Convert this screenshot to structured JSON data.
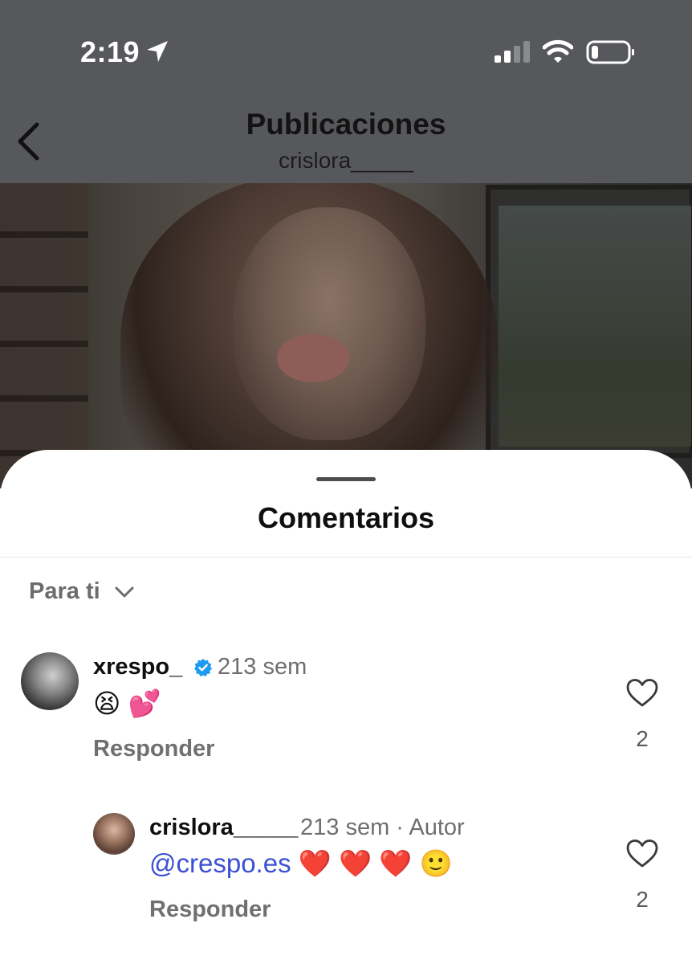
{
  "status_bar": {
    "time": "2:19"
  },
  "header": {
    "title": "Publicaciones",
    "subtitle": "crislora_____"
  },
  "comments_sheet": {
    "title": "Comentarios",
    "sort": {
      "selected": "Para ti"
    },
    "comments": [
      {
        "username": "xrespo_",
        "verified": true,
        "time": "213 sem",
        "text": "😫 💕",
        "reply_label": "Responder",
        "likes": "2"
      },
      {
        "username": "crislora_____",
        "time": "213 sem · Autor",
        "mention": "@crespo.es",
        "text": " ❤️ ❤️ ❤️ 🙂",
        "reply_label": "Responder",
        "likes": "2"
      }
    ]
  },
  "colors": {
    "mention": "#3b51d3",
    "verified_badge": "#1d9bf0"
  }
}
